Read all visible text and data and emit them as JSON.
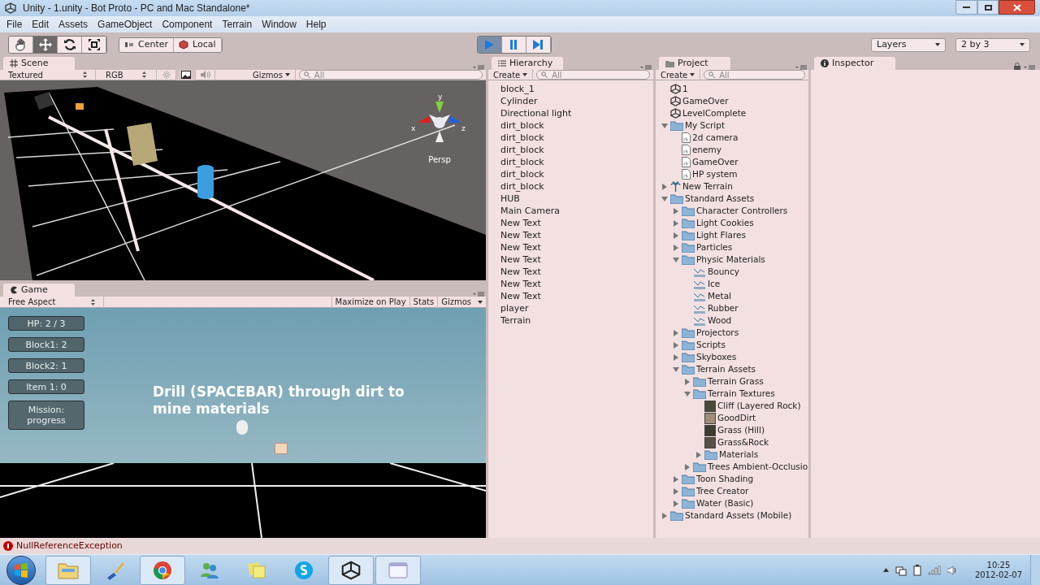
{
  "window": {
    "title": "Unity - 1.unity - Bot Proto - PC and Mac Standalone*"
  },
  "menu": [
    "File",
    "Edit",
    "Assets",
    "GameObject",
    "Component",
    "Terrain",
    "Window",
    "Help"
  ],
  "toolbar": {
    "transform_tools": [
      {
        "kind": "hand",
        "selected": false
      },
      {
        "kind": "move",
        "selected": true
      },
      {
        "kind": "rotate",
        "selected": false
      },
      {
        "kind": "scale",
        "selected": false
      }
    ],
    "pivot": [
      {
        "kind": "pivot",
        "label": "Center"
      },
      {
        "kind": "cube",
        "label": "Local"
      }
    ],
    "play_controls": [
      {
        "kind": "play",
        "selected": true
      },
      {
        "kind": "pause",
        "selected": false
      },
      {
        "kind": "step",
        "selected": false
      }
    ],
    "layers": "Layers",
    "layout": "2 by 3"
  },
  "scene": {
    "tab": "Scene",
    "toggles": [
      {
        "kind": "lighting",
        "on": false
      },
      {
        "kind": "image",
        "on": true
      },
      {
        "kind": "audio",
        "on": false
      }
    ],
    "draw_mode": "Textured",
    "render_mode": "RGB",
    "gizmos": "Gizmos",
    "search_placeholder": "All",
    "axes": [
      "y",
      "x",
      "z"
    ],
    "projection": "Persp"
  },
  "game": {
    "tab": "Game",
    "aspect": "Free Aspect",
    "buttons": [
      "Maximize on Play",
      "Stats",
      "Gizmos"
    ],
    "hud": [
      "HP: 2 / 3",
      "Block1: 2",
      "Block2: 1",
      "Item 1: 0",
      "Mission:\nprogress"
    ],
    "message": "Drill (SPACEBAR) through dirt to\nmine materials"
  },
  "hierarchy": {
    "tab": "Hierarchy",
    "create": "Create",
    "search_placeholder": "All",
    "items": [
      "block_1",
      "Cylinder",
      "Directional light",
      "dirt_block",
      "dirt_block",
      "dirt_block",
      "dirt_block",
      "dirt_block",
      "dirt_block",
      "HUB",
      "Main Camera",
      "New Text",
      "New Text",
      "New Text",
      "New Text",
      "New Text",
      "New Text",
      "New Text",
      "player",
      "Terrain"
    ]
  },
  "project": {
    "tab": "Project",
    "create": "Create",
    "search_placeholder": "All",
    "tree": [
      {
        "name": "1",
        "kind": "scene"
      },
      {
        "name": "GameOver",
        "kind": "scene"
      },
      {
        "name": "LevelComplete",
        "kind": "scene"
      },
      {
        "name": "My Script",
        "kind": "folder",
        "expanded": true,
        "children": [
          {
            "name": "2d camera",
            "kind": "script"
          },
          {
            "name": "enemy",
            "kind": "script"
          },
          {
            "name": "GameOver",
            "kind": "script"
          },
          {
            "name": "HP system",
            "kind": "script"
          }
        ]
      },
      {
        "name": "New Terrain",
        "kind": "terrain",
        "expanded": false
      },
      {
        "name": "Standard Assets",
        "kind": "folder",
        "expanded": true,
        "children": [
          {
            "name": "Character Controllers",
            "kind": "folder",
            "expanded": false
          },
          {
            "name": "Light Cookies",
            "kind": "folder",
            "expanded": false
          },
          {
            "name": "Light Flares",
            "kind": "folder",
            "expanded": false
          },
          {
            "name": "Particles",
            "kind": "folder",
            "expanded": false
          },
          {
            "name": "Physic Materials",
            "kind": "folder",
            "expanded": true,
            "children": [
              {
                "name": "Bouncy",
                "kind": "material"
              },
              {
                "name": "Ice",
                "kind": "material"
              },
              {
                "name": "Metal",
                "kind": "material"
              },
              {
                "name": "Rubber",
                "kind": "material"
              },
              {
                "name": "Wood",
                "kind": "material"
              }
            ]
          },
          {
            "name": "Projectors",
            "kind": "folder",
            "expanded": false
          },
          {
            "name": "Scripts",
            "kind": "folder",
            "expanded": false
          },
          {
            "name": "Skyboxes",
            "kind": "folder",
            "expanded": false
          },
          {
            "name": "Terrain Assets",
            "kind": "folder",
            "expanded": true,
            "children": [
              {
                "name": "Terrain Grass",
                "kind": "folder",
                "expanded": false
              },
              {
                "name": "Terrain Textures",
                "kind": "folder",
                "expanded": true,
                "children": [
                  {
                    "name": "Cliff (Layered Rock)",
                    "kind": "texture",
                    "color": "#4a4a3a"
                  },
                  {
                    "name": "GoodDirt",
                    "kind": "texture",
                    "color": "#a08c78"
                  },
                  {
                    "name": "Grass (Hill)",
                    "kind": "texture",
                    "color": "#3c3c30"
                  },
                  {
                    "name": "Grass&Rock",
                    "kind": "texture",
                    "color": "#5a5048"
                  },
                  {
                    "name": "Materials",
                    "kind": "folder",
                    "expanded": false
                  }
                ]
              },
              {
                "name": "Trees Ambient-Occlusio",
                "kind": "folder",
                "expanded": false
              }
            ]
          },
          {
            "name": "Toon Shading",
            "kind": "folder",
            "expanded": false
          },
          {
            "name": "Tree Creator",
            "kind": "folder",
            "expanded": false
          },
          {
            "name": "Water (Basic)",
            "kind": "folder",
            "expanded": false
          }
        ]
      },
      {
        "name": "Standard Assets (Mobile)",
        "kind": "folder",
        "expanded": false
      }
    ]
  },
  "inspector": {
    "tab": "Inspector"
  },
  "status": {
    "kind": "error",
    "message": "NullReferenceException"
  },
  "taskbar": {
    "apps": [
      {
        "kind": "explorer",
        "selected": true
      },
      {
        "kind": "paint",
        "selected": false
      },
      {
        "kind": "browser",
        "selected": true
      },
      {
        "kind": "messenger",
        "selected": false
      },
      {
        "kind": "notes",
        "selected": false
      },
      {
        "kind": "chat",
        "selected": false
      },
      {
        "kind": "unity",
        "selected": true
      },
      {
        "kind": "window",
        "selected": true
      }
    ],
    "time": "10:25",
    "date": "2012-02-07"
  }
}
